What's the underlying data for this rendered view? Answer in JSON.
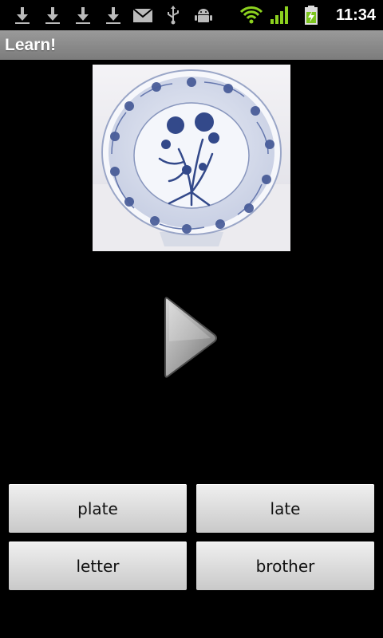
{
  "status_bar": {
    "time": "11:34",
    "icons": [
      "download-icon",
      "download-icon",
      "download-icon",
      "download-icon",
      "mail-icon",
      "usb-icon",
      "android-debug-icon",
      "wifi-icon",
      "signal-icon",
      "battery-charging-icon"
    ]
  },
  "title_bar": {
    "title": "Learn!"
  },
  "main": {
    "picture_icon": "blue-white-plate-image",
    "play_icon": "play-icon",
    "answers": [
      "plate",
      "late",
      "letter",
      "brother"
    ]
  },
  "colors": {
    "title_bar": "#8a8a8a",
    "battery_green": "#7cc51e",
    "signal_green": "#8cd11f"
  }
}
